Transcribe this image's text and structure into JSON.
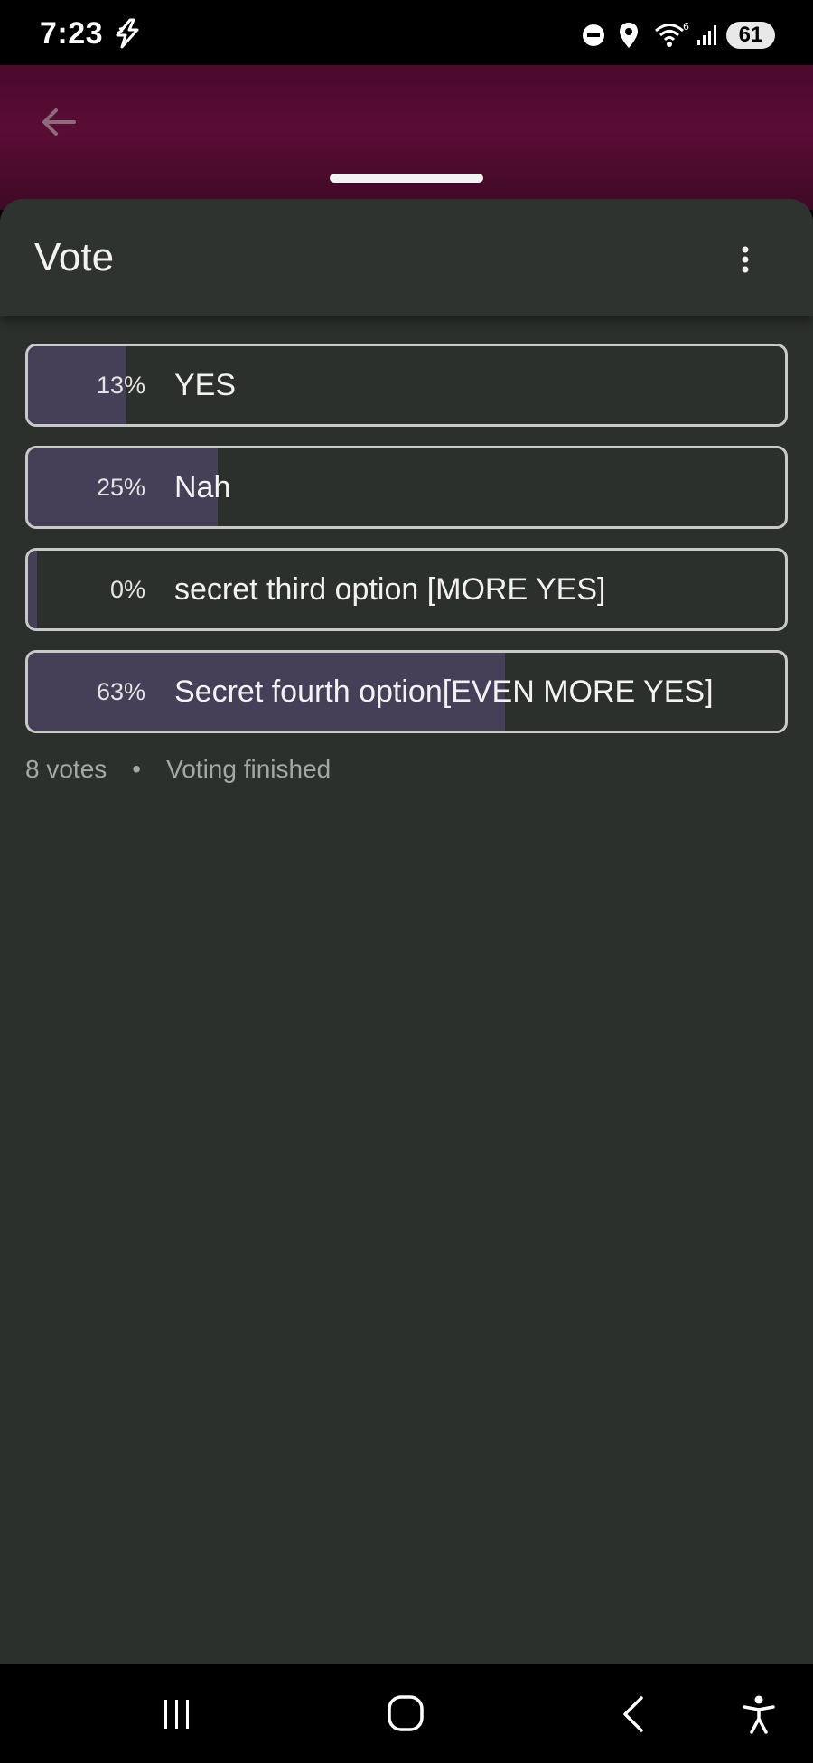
{
  "status_bar": {
    "time": "7:23",
    "battery": "61",
    "icons": [
      "bolt-icon",
      "do-not-disturb-icon",
      "location-icon",
      "wifi-icon",
      "signal-icon"
    ]
  },
  "header": {
    "back_icon": "back-arrow-icon"
  },
  "sheet": {
    "title": "Vote",
    "menu_icon": "more-vert-icon"
  },
  "poll": {
    "options": [
      {
        "percent_text": "13%",
        "label": "YES",
        "fraction": 0.13
      },
      {
        "percent_text": "25%",
        "label": "Nah",
        "fraction": 0.25
      },
      {
        "percent_text": "0%",
        "label": "secret third option [MORE YES]",
        "fraction": 0.0
      },
      {
        "percent_text": "63%",
        "label": "Secret fourth option[EVEN MORE YES]",
        "fraction": 0.63
      }
    ],
    "votes": "8 votes",
    "separator": "•",
    "status": "Voting finished"
  },
  "colors": {
    "backdrop": "#4a0a2c",
    "sheet": "#2c302c",
    "fill": "#463f58",
    "border": "#c9c9c9"
  },
  "nav_bar": {
    "icons": [
      "recent-apps-icon",
      "home-icon",
      "back-icon",
      "accessibility-icon"
    ]
  }
}
